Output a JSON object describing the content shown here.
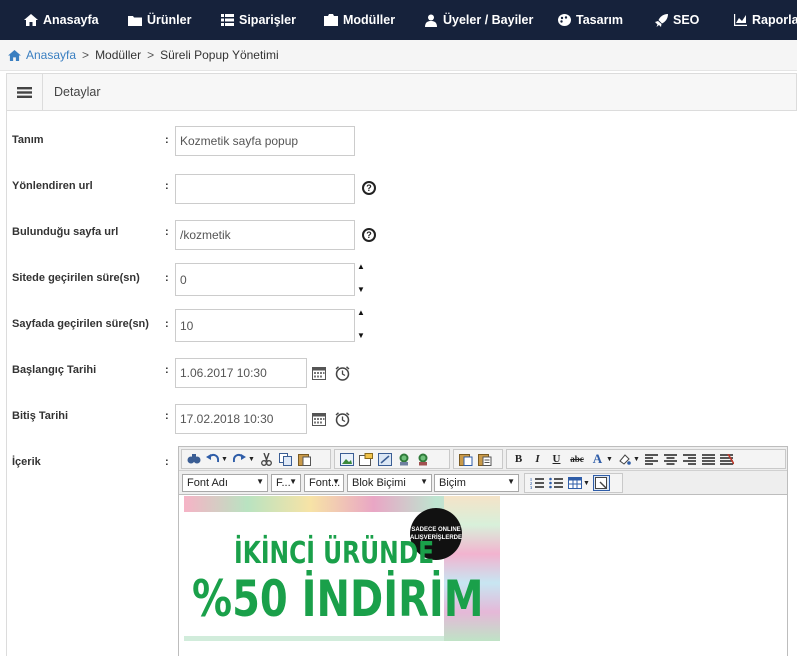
{
  "nav": {
    "items": [
      {
        "label": "Anasayfa",
        "icon": "home-icon"
      },
      {
        "label": "Ürünler",
        "icon": "folder-icon"
      },
      {
        "label": "Siparişler",
        "icon": "list-icon"
      },
      {
        "label": "Modüller",
        "icon": "module-icon"
      },
      {
        "label": "Üyeler / Bayiler",
        "icon": "users-icon"
      },
      {
        "label": "Tasarım",
        "icon": "palette-icon"
      },
      {
        "label": "SEO",
        "icon": "rocket-icon"
      },
      {
        "label": "Raporlar",
        "icon": "chart-icon"
      }
    ]
  },
  "breadcrumb": {
    "home": "Anasayfa",
    "sep": ">",
    "items": [
      "Modüller",
      "Süreli Popup Yönetimi"
    ]
  },
  "panel": {
    "title": "Detaylar"
  },
  "form": {
    "colon": ":",
    "help_symbol": "?",
    "spin_up": "▲",
    "spin_down": "▼",
    "fields": {
      "tanim": {
        "label": "Tanım",
        "value": "Kozmetik sayfa popup"
      },
      "yonlendiren_url": {
        "label": "Yönlendiren url",
        "value": ""
      },
      "bulundugu_url": {
        "label": "Bulunduğu sayfa url",
        "value": "/kozmetik"
      },
      "sitede_sure": {
        "label": "Sitede geçirilen süre(sn)",
        "value": "0"
      },
      "sayfada_sure": {
        "label": "Sayfada geçirilen süre(sn)",
        "value": "10"
      },
      "baslangic": {
        "label": "Başlangıç Tarihi",
        "value": "1.06.2017 10:30"
      },
      "bitis": {
        "label": "Bitiş Tarihi",
        "value": "17.02.2018 10:30"
      },
      "icerik": {
        "label": "İçerik"
      }
    }
  },
  "editor": {
    "bold": "B",
    "italic": "I",
    "underline": "U",
    "strike": "abc",
    "font_color": "A",
    "selects": {
      "font_name": "Font Adı",
      "font_size": "F...",
      "font_fmt": "Font...",
      "block_format": "Blok Biçimi",
      "style": "Biçim"
    },
    "banner": {
      "line1": "İKİNCİ ÜRÜNDE",
      "line2": "%50 İNDİRİM",
      "badge": "SADECE ONLINE ALIŞVERİŞLERDE"
    }
  },
  "colors": {
    "nav_bg": "#16223b",
    "link": "#3a7fc1",
    "banner_green": "#1aa04a"
  }
}
